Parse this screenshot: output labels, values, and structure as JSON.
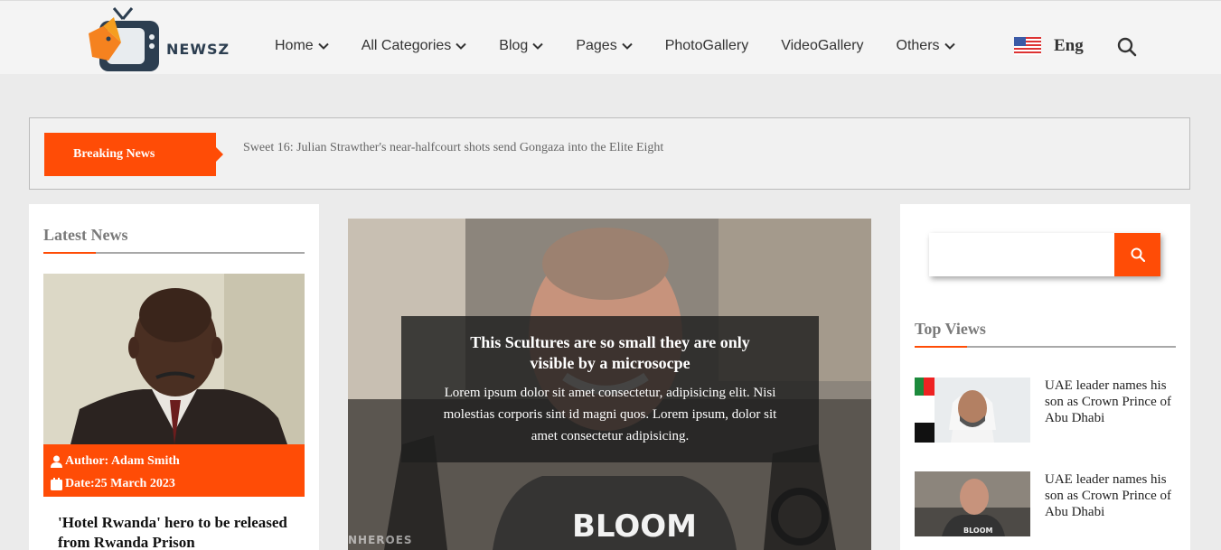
{
  "brand": {
    "name": "NEWSZ",
    "accent_color": "#ff4c06"
  },
  "nav": {
    "items": [
      {
        "label": "Home",
        "has_dropdown": true
      },
      {
        "label": "All Categories",
        "has_dropdown": true
      },
      {
        "label": "Blog",
        "has_dropdown": true
      },
      {
        "label": "Pages",
        "has_dropdown": true
      },
      {
        "label": "PhotoGallery",
        "has_dropdown": false
      },
      {
        "label": "VideoGallery",
        "has_dropdown": false
      },
      {
        "label": "Others",
        "has_dropdown": true
      }
    ],
    "language": "Eng",
    "language_icon": "us-flag-icon",
    "search_icon": "search-icon"
  },
  "breaking": {
    "label": "Breaking News",
    "headline": "Sweet 16: Julian Strawther's near-halfcourt shots send Gongaza into the Elite Eight"
  },
  "latest": {
    "title": "Latest News",
    "author": "Author: Adam Smith",
    "date": "Date:25 March 2023",
    "headline": "'Hotel Rwanda' hero to be released from Rwanda Prison"
  },
  "hero": {
    "title": "This Scultures are so small they are only visible by a microsocpe",
    "body": "Lorem ipsum dolor sit amet consectetur, adipisicing elit. Nisi molestias corporis sint id magni quos. Lorem ipsum, dolor sit amet consectetur adipisicing.",
    "watermark": "NHEROES",
    "shirt_text": "BLOOM"
  },
  "sidebar": {
    "search_placeholder": "",
    "top_views_title": "Top Views",
    "items": [
      {
        "text": "UAE leader names his son as Crown Prince of Abu Dhabi"
      },
      {
        "text": "UAE leader names his son as Crown Prince of Abu Dhabi"
      }
    ]
  }
}
